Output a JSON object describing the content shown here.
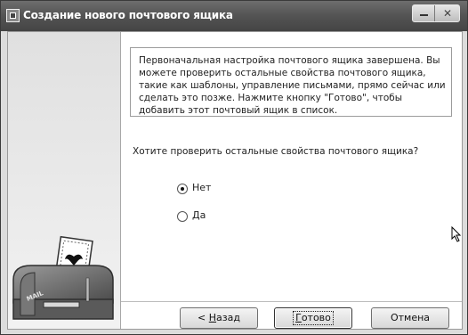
{
  "window": {
    "title": "Создание нового почтового ящика",
    "close_glyph": "✕"
  },
  "info": {
    "text": "Первоначальная настройка почтового ящика завершена. Вы можете проверить остальные свойства почтового ящика, такие как шаблоны, управление письмами, прямо сейчас или сделать это позже. Нажмите кнопку \"Готово\", чтобы добавить этот почтовый ящик в список."
  },
  "question": "Хотите проверить остальные свойства почтового ящика?",
  "options": [
    {
      "label": "Нет",
      "checked": true
    },
    {
      "label": "Да",
      "checked": false
    }
  ],
  "illustration": {
    "mailbox_label": "MAIL"
  },
  "buttons": {
    "back": {
      "prefix": "< ",
      "access_key": "Н",
      "rest": "азад"
    },
    "finish": {
      "access_key": "Г",
      "rest": "отово"
    },
    "cancel": "Отмена"
  }
}
